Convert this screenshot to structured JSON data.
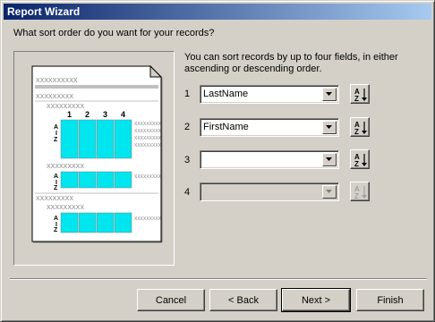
{
  "window": {
    "title": "Report Wizard"
  },
  "question": "What sort order do you want for your records?",
  "description": "You can sort records by up to four fields, in either ascending or descending order.",
  "preview": {
    "header_placeholder": "XXXXXXXXXX",
    "group_placeholder": "XXXXXXXXX",
    "column_numbers": [
      "1",
      "2",
      "3",
      "4"
    ],
    "sort_arrow_top": "A",
    "sort_arrow_bottom": "Z"
  },
  "sort_fields": [
    {
      "number": "1",
      "value": "LastName",
      "enabled": true
    },
    {
      "number": "2",
      "value": "FirstName",
      "enabled": true
    },
    {
      "number": "3",
      "value": "",
      "enabled": true
    },
    {
      "number": "4",
      "value": "",
      "enabled": false
    }
  ],
  "sort_button": {
    "icon": "sort-ascending-icon",
    "top_letter": "A",
    "bottom_letter": "Z"
  },
  "buttons": {
    "cancel": "Cancel",
    "back": "< Back",
    "next": "Next >",
    "finish": "Finish"
  },
  "colors": {
    "titlebar_start": "#0a246a",
    "titlebar_end": "#a6caf0",
    "preview_cells": "#00e5ee"
  }
}
